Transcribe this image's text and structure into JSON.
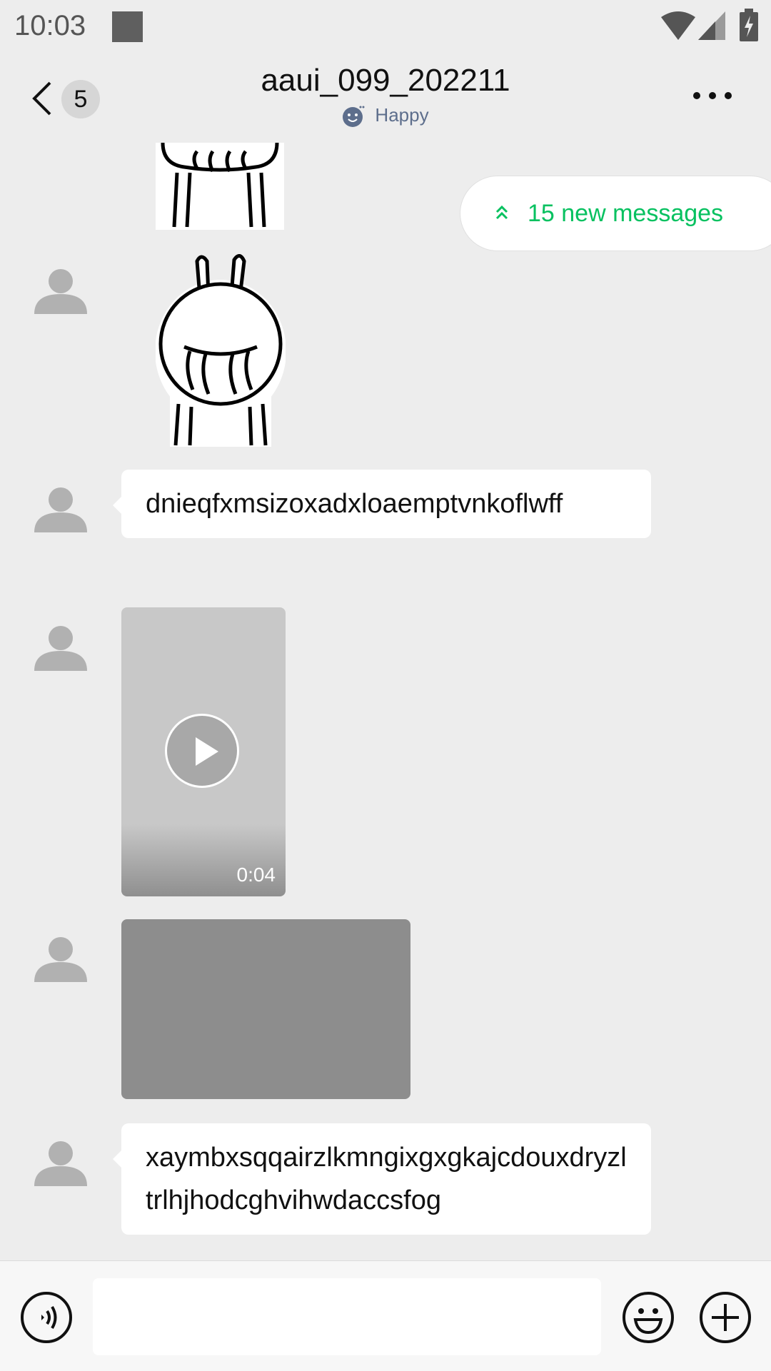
{
  "status_bar": {
    "time": "10:03"
  },
  "header": {
    "back_count": "5",
    "title": "aaui_099_202211",
    "status_text": "Happy"
  },
  "chat": {
    "new_messages_label": "15 new messages",
    "messages": [
      {
        "type": "sticker"
      },
      {
        "type": "sticker"
      },
      {
        "type": "text",
        "text": "dnieqfxmsizoxadxloaemptvnkoflwff"
      },
      {
        "type": "video",
        "duration": "0:04"
      },
      {
        "type": "image"
      },
      {
        "type": "text",
        "text": "xaymbxsqqairzlkmngixgxgkajcdouxdryzltrlhjhodcghvihwdaccsfog"
      }
    ]
  },
  "input_bar": {
    "placeholder": ""
  },
  "colors": {
    "accent": "#07c160",
    "background": "#ededed",
    "status_blue": "#5d6e8c"
  }
}
